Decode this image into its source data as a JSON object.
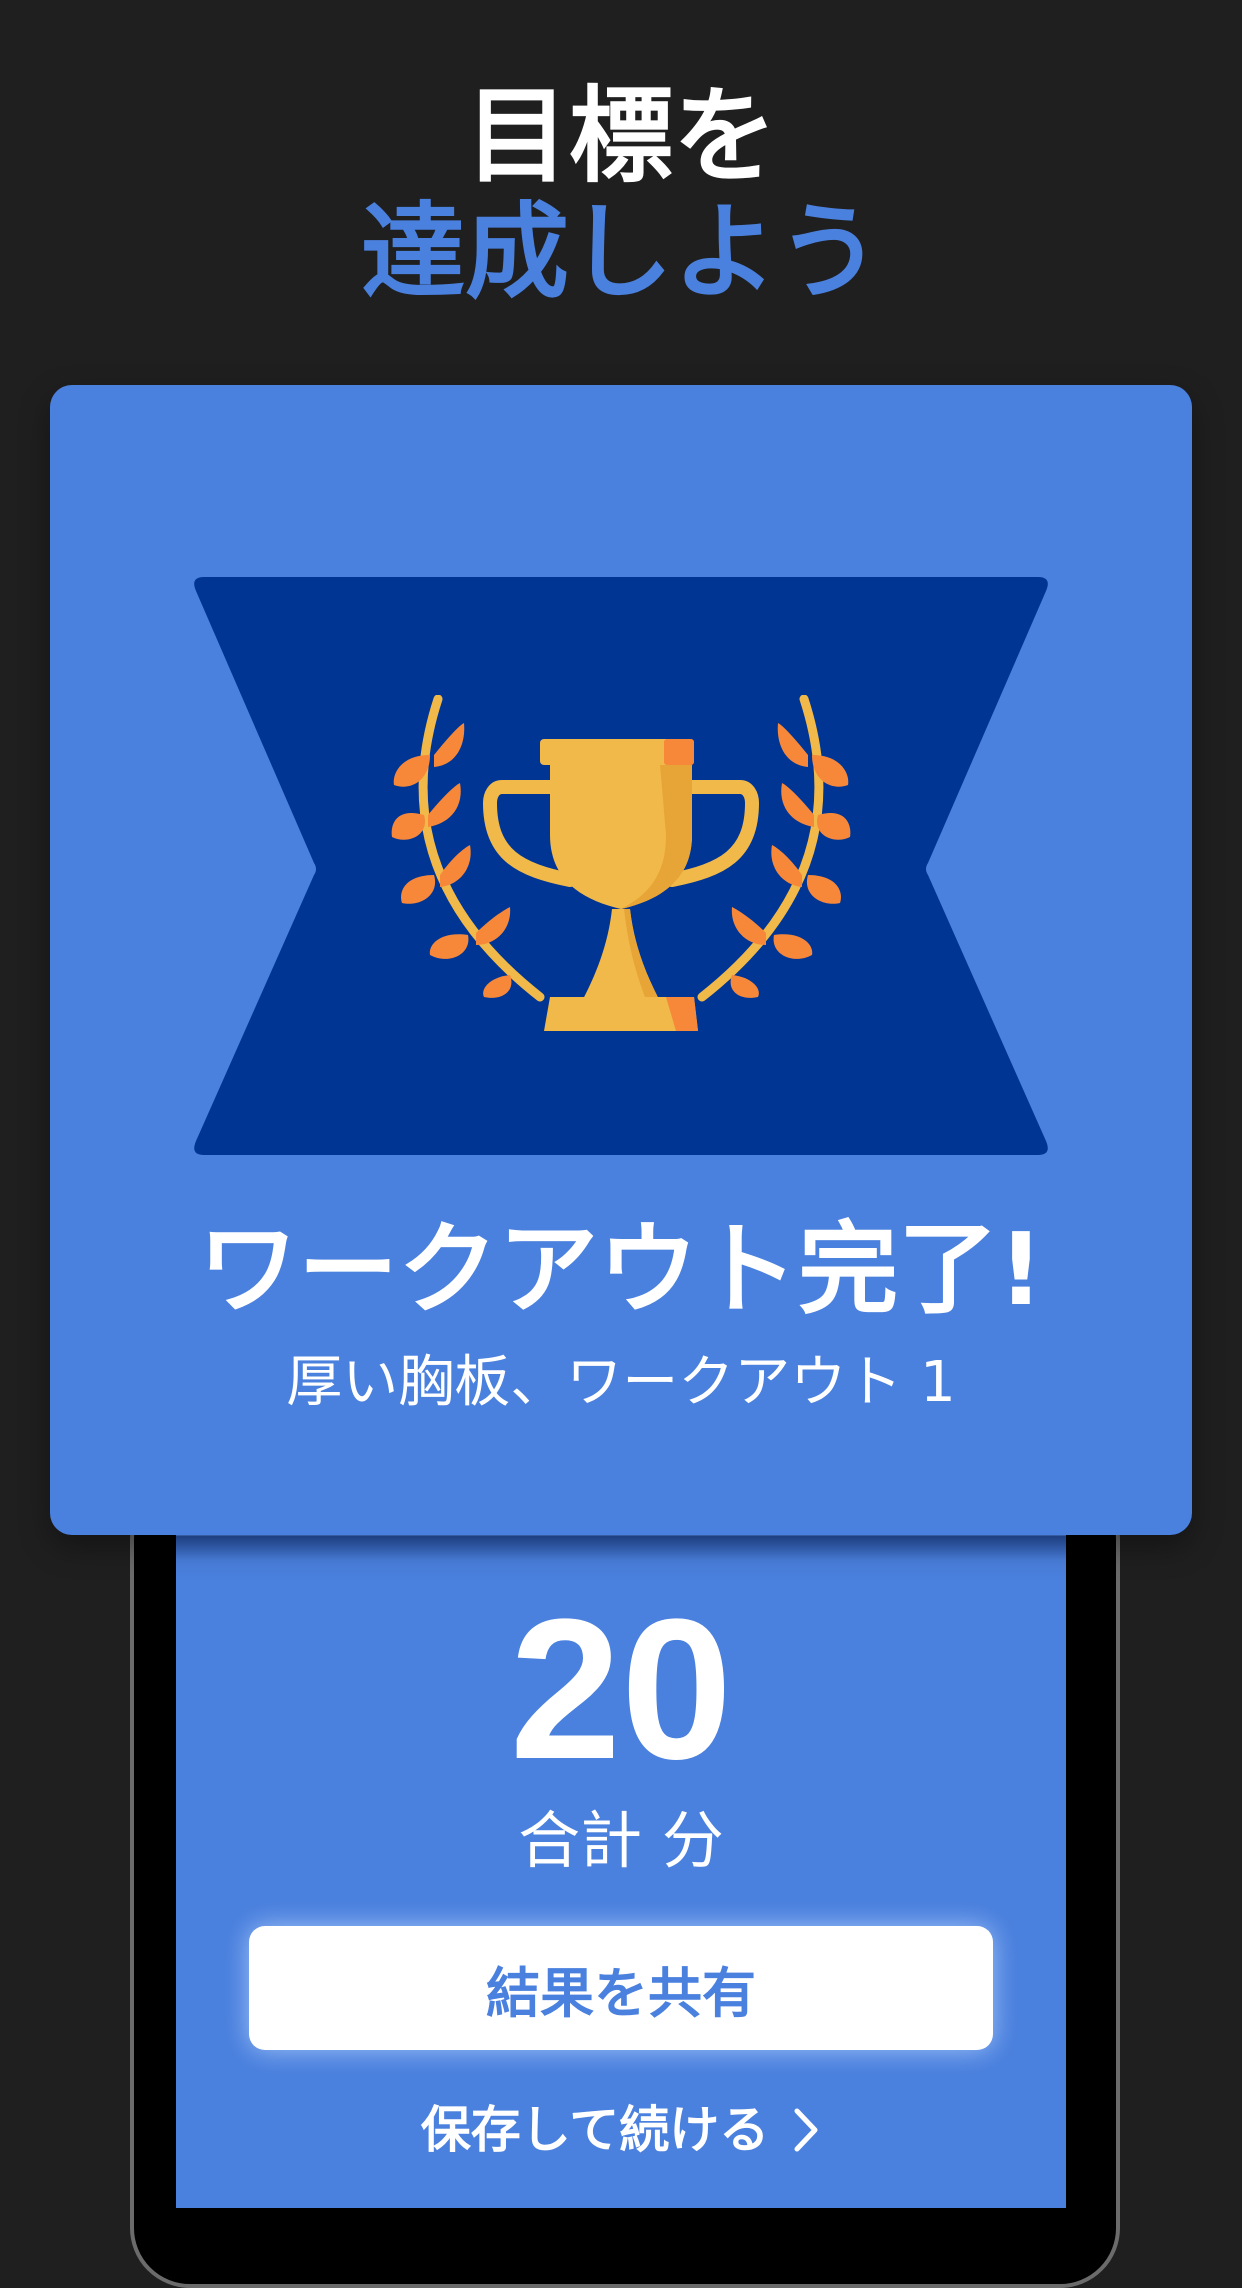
{
  "header": {
    "line1": "目標を",
    "line2": "達成しよう"
  },
  "card": {
    "title": "ワークアウト完了!",
    "subtitle": "厚い胸板、ワークアウト 1"
  },
  "stats": {
    "minutes": "20",
    "unit_label": "合計 分"
  },
  "actions": {
    "share_label": "結果を共有",
    "continue_label": "保存して続ける"
  },
  "colors": {
    "background": "#1f1f1f",
    "accent_blue": "#4a80de",
    "ribbon_navy": "#003594",
    "trophy_gold": "#f0b94a",
    "laurel_orange": "#f7883a"
  },
  "icons": [
    "trophy-icon",
    "laurel-icon",
    "chevron-right-icon"
  ]
}
